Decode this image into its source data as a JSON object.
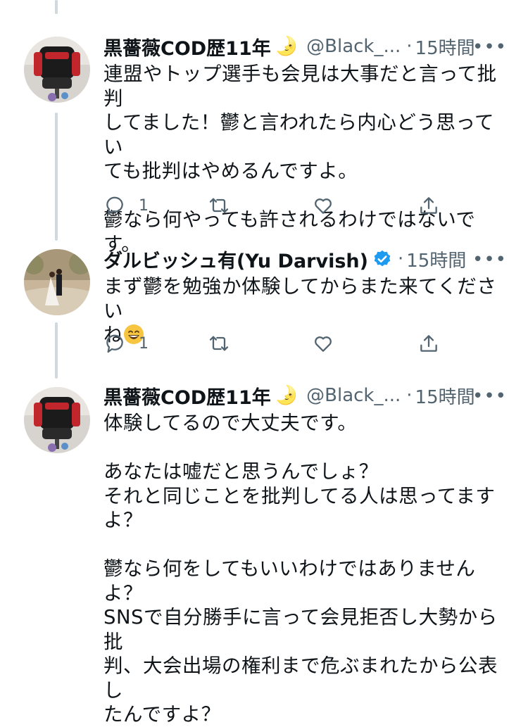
{
  "tweets": [
    {
      "name": "黒薔薇COD歴11年",
      "badge_emoji": "🌛",
      "handle": "@Black_...",
      "dot": "·",
      "time": "15時間",
      "more": "•••",
      "lines_p1": [
        "連盟やトップ選手も会見は大事だと言って批判",
        "してました！鬱と言われたら内心どう思ってい",
        "ても批判はやめるんですよ。"
      ],
      "lines_p2": [
        "鬱なら何やっても許されるわけではないです。"
      ],
      "reply_count": "1"
    },
    {
      "name": "ダルビッシュ有(Yu Darvish)",
      "verified": true,
      "dot": "·",
      "time": "15時間",
      "more": "•••",
      "lines": [
        "まず鬱を勉強か体験してからまた来てくださ い",
        "ね"
      ],
      "emoji": "grinning-face",
      "reply_count": "1"
    },
    {
      "name": "黒薔薇COD歴11年",
      "badge_emoji": "🌛",
      "handle": "@Black_...",
      "dot": "·",
      "time": "15時間",
      "more": "•••",
      "lines_p1": [
        "体験してるので大丈夫です。"
      ],
      "lines_p2": [
        "あなたは嘘だと思うんでしょ？",
        "それと同じことを批判してる人は思ってます",
        "よ？"
      ],
      "lines_p3": [
        "鬱なら何をしてもいいわけではありませんよ？",
        "SNSで自分勝手に言って会見拒否し大勢から批",
        "判、大会出場の権利まで危ぶまれたから公表し",
        "たんですよ？"
      ]
    }
  ],
  "icons": [
    "reply-icon",
    "retweet-icon",
    "like-icon",
    "share-icon",
    "verified-badge-icon"
  ],
  "colors": {
    "text": "#0f1419",
    "secondary": "#536471",
    "verified": "#1d9bf0",
    "thread_line": "#cfd9de"
  }
}
